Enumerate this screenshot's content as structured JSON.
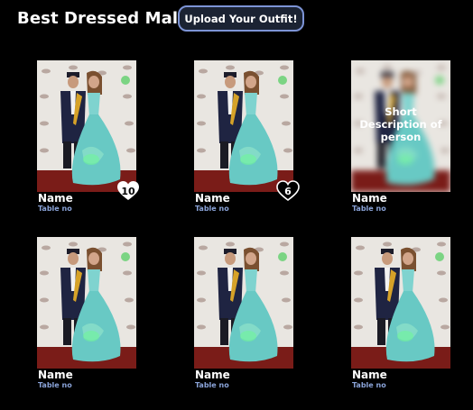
{
  "header": {
    "title": "Best Dressed Male",
    "upload_label": "Upload Your Outfit!"
  },
  "colors": {
    "background": "#000000",
    "accent_border": "#7d94d6",
    "table_no": "#8aa3d8"
  },
  "cards": [
    {
      "name": "Name",
      "table_no": "Table no",
      "likes": "10",
      "heart": "filled"
    },
    {
      "name": "Name",
      "table_no": "Table no",
      "likes": "6",
      "heart": "outline"
    },
    {
      "name": "Name",
      "table_no": "Table no",
      "description": "Short Description of person"
    },
    {
      "name": "Name",
      "table_no": "Table no"
    },
    {
      "name": "Name",
      "table_no": "Table no"
    },
    {
      "name": "Name",
      "table_no": "Table no"
    }
  ]
}
